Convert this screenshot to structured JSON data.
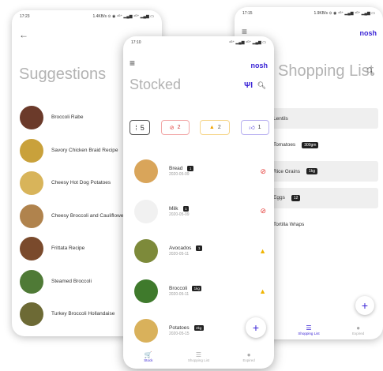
{
  "colors": {
    "accent": "#3b25d6",
    "expired": "#e53935",
    "expiring": "#f0b400",
    "muted_title": "#b3b3b3"
  },
  "left_screen": {
    "status_time": "17:23",
    "status_icons": "1.4KB/s ⊙ ◉ ⁴ᴳ⁺ ▂▄▆ ⁴ᴳ⁺ ▂▄▆ ▭",
    "back_icon": "arrow-left-icon",
    "title": "Suggestions",
    "items": [
      {
        "label": "Broccoli Rabe",
        "thumb_color": "#6b3a2a"
      },
      {
        "label": "Savory Chicken Braid Recipe",
        "thumb_color": "#c9a13b"
      },
      {
        "label": "Cheesy Hot Dog Potatoes",
        "thumb_color": "#d8b45a"
      },
      {
        "label": "Cheesy Broccoli and Cauliflower",
        "thumb_color": "#b0834d"
      },
      {
        "label": "Frittata Recipe",
        "thumb_color": "#7a4a2c"
      },
      {
        "label": "Steamed Broccoli",
        "thumb_color": "#4f7a36"
      },
      {
        "label": "Turkey Broccoli Hollandaise",
        "thumb_color": "#6d6a35"
      }
    ]
  },
  "middle_screen": {
    "status_time": "17:10",
    "status_icons": "⁴ᴳ⁺ ▂▄▆ ⁴ᴳ⁺ ▂▄▆ ▭",
    "menu_icon": "hamburger-menu-icon",
    "logo": "nosh",
    "title": "Stocked",
    "chips": {
      "total": "5",
      "expired_count": "2",
      "expiring_count": "2",
      "liked_count": "1"
    },
    "items": [
      {
        "name": "Bread",
        "qty": "1",
        "date": "2020-05-09",
        "status": "expired",
        "thumb_color": "#d9a55a"
      },
      {
        "name": "Milk",
        "qty": "1",
        "date": "2020-05-09",
        "status": "expired",
        "thumb_color": "#f1f1f1"
      },
      {
        "name": "Avocados",
        "qty": "1",
        "date": "2020-05-11",
        "status": "expiring",
        "thumb_color": "#7d8a3a"
      },
      {
        "name": "Broccoli",
        "qty": "1kg",
        "date": "2020-05-11",
        "status": "expiring",
        "thumb_color": "#3f7a2c"
      },
      {
        "name": "Potatoes",
        "qty": "2kg",
        "date": "2020-05-15",
        "status": "none",
        "thumb_color": "#d9b15b"
      }
    ],
    "fab_label": "+",
    "nav": [
      {
        "label": "Stock",
        "icon": "cart-icon",
        "glyph": "🛒",
        "active": true
      },
      {
        "label": "Shopping List",
        "icon": "list-icon",
        "glyph": "☰",
        "active": false
      },
      {
        "label": "Expired",
        "icon": "clock-icon",
        "glyph": "●",
        "active": false
      }
    ]
  },
  "right_screen": {
    "status_time": "17:15",
    "status_icons": "1.9KB/s ⊙ ◉ ⁴ᴳ⁺ ▂▄▆ ⁴ᴳ⁺ ▂▄▆ ▭",
    "menu_icon": "hamburger-menu-icon",
    "logo": "nosh",
    "title": "Shopping List",
    "items": [
      {
        "name": "Lentils",
        "qty": "",
        "shaded": true
      },
      {
        "name": "Tomatoes",
        "qty": "300gm",
        "shaded": false
      },
      {
        "name": "Rice Grains",
        "qty": "1kg",
        "shaded": true
      },
      {
        "name": "Eggs",
        "qty": "12",
        "shaded": true
      },
      {
        "name": "Tortilla Wraps",
        "qty": "",
        "shaded": false
      }
    ],
    "fab_label": "+",
    "nav": [
      {
        "label": "Stock",
        "icon": "cart-icon",
        "glyph": "🛒",
        "active": false
      },
      {
        "label": "Shopping List",
        "icon": "list-icon",
        "glyph": "☰",
        "active": true
      },
      {
        "label": "Expired",
        "icon": "clock-icon",
        "glyph": "●",
        "active": false
      }
    ]
  }
}
